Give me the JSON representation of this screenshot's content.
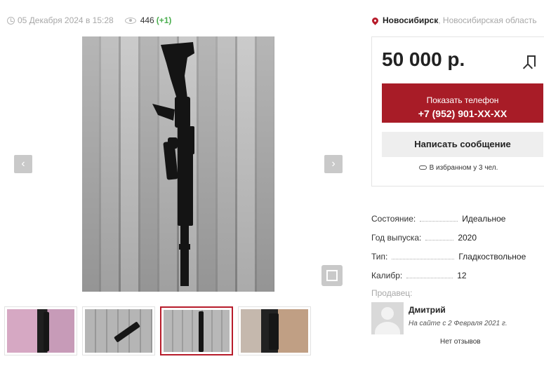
{
  "listing": {
    "posted_at": "05 Декабря 2024 в 15:28",
    "views": "446",
    "views_delta": "(+1)"
  },
  "location": {
    "city": "Новосибирск",
    "region": ", Новосибирская область"
  },
  "price_card": {
    "price": "50 000 р.",
    "show_phone_label": "Показать телефон",
    "phone": "+7 (952) 901-XX-XX",
    "message_label": "Написать сообщение",
    "favorites_text": "В избранном у 3 чел."
  },
  "specs": [
    {
      "key": "Состояние:",
      "value": "Идеальное"
    },
    {
      "key": "Год выпуска:",
      "value": "2020"
    },
    {
      "key": "Тип:",
      "value": "Гладкоствольное"
    },
    {
      "key": "Калибр:",
      "value": "12"
    }
  ],
  "seller": {
    "title": "Продавец:",
    "name": "Дмитрий",
    "since": "На сайте с 2 Февраля 2021 г.",
    "reviews": "Нет отзывов"
  },
  "gallery": {
    "prev_icon": "chevron-left-icon",
    "next_icon": "chevron-right-icon",
    "fullscreen_icon": "fullscreen-icon",
    "thumbnail_count": 4,
    "active_thumbnail": 3
  },
  "colors": {
    "accent": "#a81c27",
    "active_border": "#b71c2b",
    "positive": "#4caf50"
  }
}
